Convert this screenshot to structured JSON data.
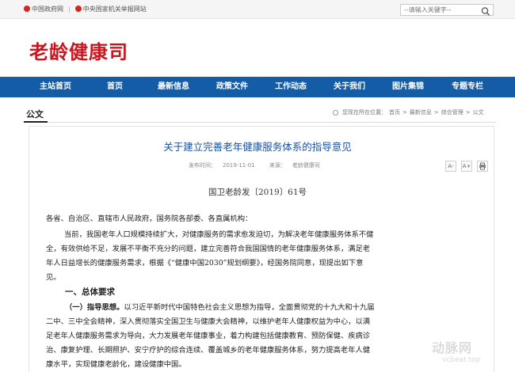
{
  "topbar": {
    "link_gov": "中国政府网",
    "sep": "|",
    "link_report": "中央国家机关举报网站",
    "search_placeholder": "--请输入关键字--"
  },
  "site": {
    "title": "老龄健康司"
  },
  "nav": {
    "items": [
      "主站首页",
      "首页",
      "最新信息",
      "政策文件",
      "工作动态",
      "关于我们",
      "图片集锦",
      "专题专栏"
    ]
  },
  "section": {
    "title": "公文"
  },
  "breadcrumb": {
    "label": "您现在所在位置：",
    "items": [
      "首页",
      "最新信息",
      "综合管理",
      "公文"
    ],
    "sep": ">"
  },
  "article": {
    "title": "关于建立完善老年健康服务体系的指导意见",
    "pub_label": "发布时间：",
    "pub_date": "2019-11-01",
    "source_label": "来源：",
    "source": "老龄健康司",
    "tools": {
      "font_small": "A-",
      "font_large": "A+"
    },
    "docno": "国卫老龄发〔2019〕61号",
    "addressee": "各省、自治区、直辖市人民政府，国务院各部委、各直属机构：",
    "intro_lines": [
      "当前，我国老年人口规模持续扩大，对健康服务的需求愈发迫切，为解决老年健康服务体系不健",
      "全，有效供给不足，发展不平衡不充分的问题，建立完善符合我国国情的老年健康服务体系，满足老",
      "年人日益增长的健康服务需求，根据《“健康中国2030”规划纲要》，经国务院同意，现提出如下意",
      "见。"
    ],
    "h1": "一、总体要求",
    "h2_label": "（一）指导思想。",
    "h2_lines": [
      "以习近平新时代中国特色社会主义思想为指导，全面贯彻党的十九大和十九届",
      "二中、三中全会精神，深入贯彻落实全国卫生与健康大会精神，以维护老年人健康权益为中心，以满",
      "足老年人健康服务需求为导向，大力发展老年健康事业，着力构建包括健康教育、预防保健、疾病诊",
      "治、康复护理、长期照护、安宁疗护的综合连续、覆盖城乡的老年健康服务体系，努力提高老年人健",
      "康水平，实现健康老龄化，建设健康中国。"
    ]
  },
  "watermark": {
    "brand": "动脉网",
    "url": "vcbeat.top"
  },
  "colors": {
    "nav": "#155ca7",
    "logo": "#c9151e",
    "title": "#1a4f9c"
  }
}
